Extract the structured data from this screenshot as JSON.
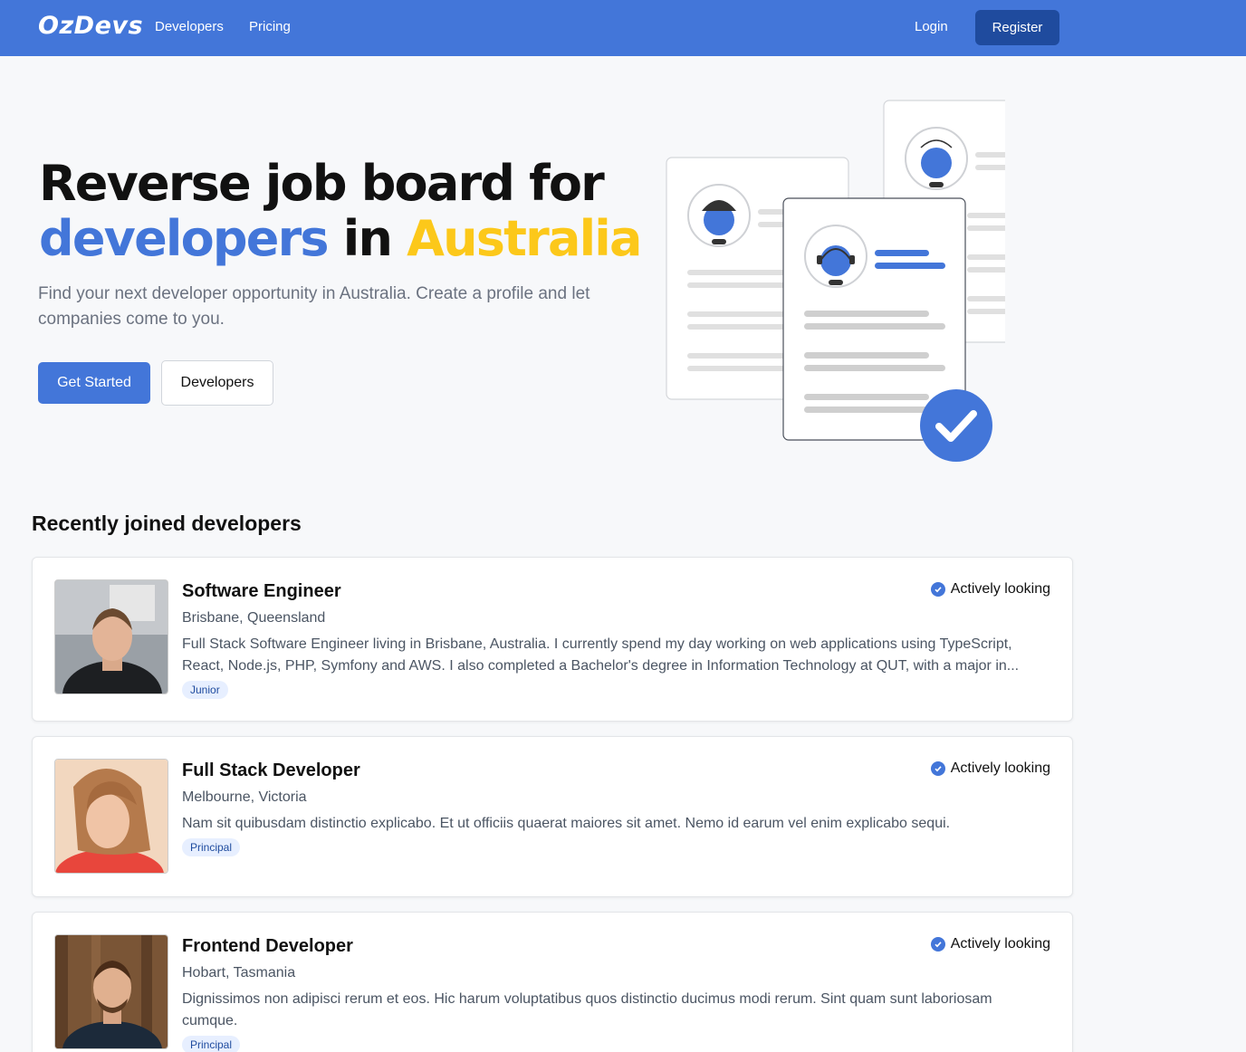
{
  "nav": {
    "logo": "OzDevs",
    "links": [
      "Developers",
      "Pricing"
    ],
    "login": "Login",
    "register": "Register"
  },
  "hero": {
    "title_line1": "Reverse job board for",
    "title_blue": "developers",
    "title_in": " in ",
    "title_yellow": "Australia",
    "subtitle": "Find your next developer opportunity in Australia. Create a profile and let companies come to you.",
    "cta_primary": "Get Started",
    "cta_secondary": "Developers"
  },
  "section": {
    "title": "Recently joined developers"
  },
  "developers": [
    {
      "title": "Software Engineer",
      "location": "Brisbane, Queensland",
      "bio": "Full Stack Software Engineer living in Brisbane, Australia. I currently spend my day working on web applications using TypeScript, React, Node.js, PHP, Symfony and AWS. I also completed a Bachelor's degree in Information Technology at QUT, with a major in...",
      "tag": "Junior",
      "status": "Actively looking"
    },
    {
      "title": "Full Stack Developer",
      "location": "Melbourne, Victoria",
      "bio": "Nam sit quibusdam distinctio explicabo. Et ut officiis quaerat maiores sit amet. Nemo id earum vel enim explicabo sequi.",
      "tag": "Principal",
      "status": "Actively looking"
    },
    {
      "title": "Frontend Developer",
      "location": "Hobart, Tasmania",
      "bio": "Dignissimos non adipisci rerum et eos. Hic harum voluptatibus quos distinctio ducimus modi rerum. Sint quam sunt laboriosam cumque.",
      "tag": "Principal",
      "status": "Actively looking"
    }
  ],
  "colors": {
    "brand": "#4376d9",
    "brand_dark": "#1f4b9e",
    "accent_yellow": "#fcc81a"
  }
}
